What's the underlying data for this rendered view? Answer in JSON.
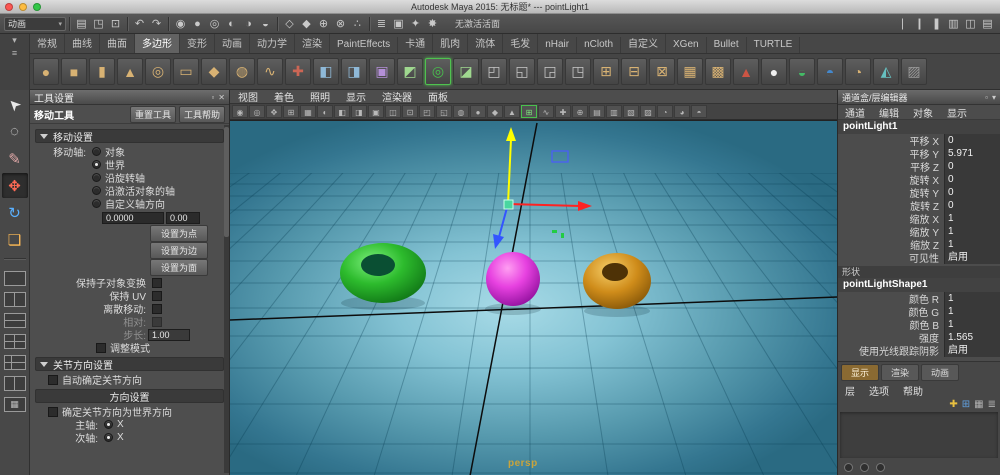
{
  "colors": {
    "close": "#fc5753",
    "minimize": "#fdbc40",
    "zoom": "#33c748",
    "selected": "#4fc24f",
    "viewport_center": "#a8dbe7",
    "viewport_edge": "#2a6a82",
    "object_green": "#2dbb2d",
    "object_magenta": "#e741e0",
    "object_orange": "#cf8c1a",
    "manip_x": "#ff2222",
    "manip_y": "#ffff00",
    "manip_z": "#3355ff"
  },
  "window": {
    "title": "Autodesk Maya 2015: 无标题*  ---  pointLight1"
  },
  "menubar": {
    "selector_label": "动画",
    "status_text": "无激活活面",
    "icon_groups": [
      [
        {
          "g": "▤",
          "n": "new-scene"
        },
        {
          "g": "◳",
          "n": "open-scene"
        },
        {
          "g": "⊡",
          "n": "save-scene"
        }
      ],
      [
        {
          "g": "↶",
          "n": "undo"
        },
        {
          "g": "↷",
          "n": "redo"
        }
      ],
      [
        {
          "g": "◉",
          "n": "select-hierarchy"
        },
        {
          "g": "●",
          "n": "select-object"
        },
        {
          "g": "◎",
          "n": "select-component"
        },
        {
          "g": "◐",
          "n": "select-mask-a"
        },
        {
          "g": "◑",
          "n": "select-mask-b"
        },
        {
          "g": "◒",
          "n": "select-mask-c"
        }
      ],
      [
        {
          "g": "◇",
          "n": "snap-grid"
        },
        {
          "g": "◆",
          "n": "snap-curve"
        },
        {
          "g": "⊕",
          "n": "snap-point"
        },
        {
          "g": "⊗",
          "n": "snap-plane"
        },
        {
          "g": "∴",
          "n": "snap-surface"
        }
      ],
      [
        {
          "g": "≣",
          "n": "construction-history"
        },
        {
          "g": "▣",
          "n": "render-frame"
        },
        {
          "g": "✦",
          "n": "ipr-render"
        },
        {
          "g": "✸",
          "n": "render-settings"
        }
      ]
    ],
    "right_icons": [
      {
        "g": "❘",
        "n": "sidebar-toggle-a"
      },
      {
        "g": "❙",
        "n": "sidebar-toggle-b"
      },
      {
        "g": "❚",
        "n": "sidebar-toggle-c"
      },
      {
        "g": "▥",
        "n": "channelbox-toggle"
      },
      {
        "g": "◫",
        "n": "attribute-editor-toggle"
      },
      {
        "g": "▤",
        "n": "toolsettings-toggle"
      }
    ]
  },
  "shelf": {
    "corner_icons": [
      {
        "g": "▾",
        "n": "shelf-tab-arrow"
      },
      {
        "g": "≡",
        "n": "shelf-menu"
      }
    ],
    "active_tab": "多边形",
    "tabs": [
      "常规",
      "曲线",
      "曲面",
      "多边形",
      "变形",
      "动画",
      "动力学",
      "渲染",
      "PaintEffects",
      "卡通",
      "肌肉",
      "流体",
      "毛发",
      "nHair",
      "nCloth",
      "自定义",
      "XGen",
      "Bullet",
      "TURTLE"
    ],
    "icons": [
      {
        "g": "●",
        "c": "#d8b273",
        "n": "poly-sphere"
      },
      {
        "g": "■",
        "c": "#d8b273",
        "n": "poly-cube"
      },
      {
        "g": "▮",
        "c": "#d8b273",
        "n": "poly-cylinder"
      },
      {
        "g": "▲",
        "c": "#d8b273",
        "n": "poly-cone"
      },
      {
        "g": "◎",
        "c": "#d8b273",
        "n": "poly-torus"
      },
      {
        "g": "▭",
        "c": "#d8b273",
        "n": "poly-plane"
      },
      {
        "g": "◆",
        "c": "#d8b273",
        "n": "poly-prism"
      },
      {
        "g": "◍",
        "c": "#d8b273",
        "n": "poly-pipe"
      },
      {
        "g": "∿",
        "c": "#d8b273",
        "n": "poly-helix"
      },
      {
        "g": "✚",
        "c": "#cc6655",
        "n": "poly-plus"
      },
      {
        "g": "◧",
        "c": "#8fb9d8",
        "n": "combine"
      },
      {
        "g": "◨",
        "c": "#8fb9d8",
        "n": "separate"
      },
      {
        "g": "▣",
        "c": "#b48fd8",
        "n": "boolean-cube"
      },
      {
        "g": "◩",
        "c": "#9fd88f",
        "n": "smooth"
      },
      {
        "g": "◎",
        "c": "#49c04d",
        "n": "poly-torus-active",
        "sel": true
      },
      {
        "g": "◪",
        "c": "#9fd88f",
        "n": "extrude"
      },
      {
        "g": "◰",
        "c": "#c8c8c8",
        "n": "bridge"
      },
      {
        "g": "◱",
        "c": "#c8c8c8",
        "n": "append"
      },
      {
        "g": "◲",
        "c": "#c8c8c8",
        "n": "split"
      },
      {
        "g": "◳",
        "c": "#c8c8c8",
        "n": "insert-edge-loop"
      },
      {
        "g": "⊞",
        "c": "#d8b273",
        "n": "bevel"
      },
      {
        "g": "⊟",
        "c": "#d8b273",
        "n": "reduce"
      },
      {
        "g": "⊠",
        "c": "#d8b273",
        "n": "triangulate"
      },
      {
        "g": "▦",
        "c": "#d8b273",
        "n": "quadrangulate"
      },
      {
        "g": "▩",
        "c": "#d8b273",
        "n": "mirror"
      },
      {
        "g": "▲",
        "c": "#cc5544",
        "n": "cone-red"
      },
      {
        "g": "●",
        "c": "#efefef",
        "n": "sphere-white"
      },
      {
        "g": "◒",
        "c": "#44bb66",
        "n": "checker-green"
      },
      {
        "g": "◓",
        "c": "#4488cc",
        "n": "checker-blue"
      },
      {
        "g": "◔",
        "c": "#d8b273",
        "n": "checker-gold"
      },
      {
        "g": "◭",
        "c": "#66c0c0",
        "n": "platonic"
      },
      {
        "g": "▨",
        "c": "#9a9a9a",
        "n": "texture-tile"
      }
    ]
  },
  "toolbox": {
    "tools": [
      {
        "g": "➤",
        "c": "#e8e8e8",
        "rot": -135,
        "n": "select-tool"
      },
      {
        "g": "◌",
        "c": "#e8e8e8",
        "n": "lasso-tool"
      },
      {
        "g": "✎",
        "c": "#e0a8a8",
        "n": "paint-select-tool"
      },
      {
        "g": "✥",
        "c": "#ff6a55",
        "sel": true,
        "n": "move-tool"
      },
      {
        "g": "↻",
        "c": "#5ab0ff",
        "n": "rotate-tool"
      },
      {
        "g": "❏",
        "c": "#ffbb55",
        "n": "scale-tool"
      }
    ],
    "layouts": [
      {
        "cls": "lo1",
        "n": "layout-single-pane"
      },
      {
        "cls": "lo2v",
        "n": "layout-two-panes-side"
      },
      {
        "cls": "lo2h",
        "n": "layout-two-panes-stacked"
      },
      {
        "cls": "lo4",
        "n": "layout-four-panes"
      },
      {
        "cls": "lo3",
        "n": "layout-three-panes"
      },
      {
        "cls": "lo2v",
        "n": "layout-outliner-persp"
      },
      {
        "g": "▦",
        "n": "layout-hypergraph"
      }
    ]
  },
  "tool_settings": {
    "panel_title": "工具设置",
    "tool_name": "移动工具",
    "reset_button": "重置工具",
    "help_button": "工具帮助",
    "move_section_header": "移动设置",
    "axis_label": "移动轴:",
    "axis_options": [
      {
        "label": "对象",
        "selected": false
      },
      {
        "label": "世界",
        "selected": true
      },
      {
        "label": "沿旋转轴",
        "selected": false
      },
      {
        "label": "沿激活对象的轴",
        "selected": false
      },
      {
        "label": "自定义轴方向",
        "selected": false
      }
    ],
    "axis_value": "0.0000",
    "axis_value2": "0.00",
    "set_buttons": [
      "设置为点",
      "设置为边",
      "设置为面"
    ],
    "keep_rows": [
      "保持子对象变换",
      "保持 UV"
    ],
    "discrete_label": "离散移动:",
    "relative_label": "相对:",
    "step_label": "步长:",
    "step_value": "1.00",
    "adjust_label": "调整模式",
    "joint_section_header": "关节方向设置",
    "auto_joint_label": "自动确定关节方向",
    "orient_subheader": "方向设置",
    "world_orient_label": "确定关节方向为世界方向",
    "primary_axis_label": "主轴:",
    "secondary_axis_label": "次轴:",
    "axis_x": "X"
  },
  "viewport": {
    "menus": [
      "视图",
      "着色",
      "照明",
      "显示",
      "渲染器",
      "面板"
    ],
    "toolbar_icons": [
      {
        "g": "◉",
        "n": "select-camera"
      },
      {
        "g": "◎",
        "n": "lock-camera"
      },
      {
        "g": "✥",
        "n": "camera-attributes"
      },
      {
        "g": "⊞",
        "n": "bookmark"
      },
      {
        "g": "▦",
        "n": "image-plane"
      },
      {
        "g": "◐",
        "n": "two-d-pan-zoom"
      },
      {
        "g": "◧",
        "n": "grease-pencil"
      },
      {
        "g": "◨",
        "n": "grid-toggle"
      },
      {
        "g": "▣",
        "n": "film-gate"
      },
      {
        "g": "◫",
        "n": "resolution-gate"
      },
      {
        "g": "⊡",
        "n": "gate-mask"
      },
      {
        "g": "◰",
        "n": "field-chart"
      },
      {
        "g": "◱",
        "n": "safe-action"
      },
      {
        "g": "◍",
        "n": "safe-title"
      },
      {
        "g": "●",
        "n": "wireframe-mode"
      },
      {
        "g": "◆",
        "n": "shaded-mode"
      },
      {
        "g": "▲",
        "n": "textured-mode"
      },
      {
        "g": "⊞",
        "c": "#7ee07e",
        "sel": true,
        "n": "use-all-lights"
      },
      {
        "g": "∿",
        "n": "shadows-toggle"
      },
      {
        "g": "✚",
        "n": "screen-space-ao"
      },
      {
        "g": "⊕",
        "n": "motion-blur"
      },
      {
        "g": "▤",
        "n": "multisample-aa"
      },
      {
        "g": "▥",
        "n": "sequence-time"
      },
      {
        "g": "▧",
        "n": "xray-mode"
      },
      {
        "g": "▨",
        "n": "xray-joints"
      },
      {
        "g": "◔",
        "n": "isolate-select"
      },
      {
        "g": "◕",
        "n": "exposure"
      },
      {
        "g": "◓",
        "n": "gamma"
      }
    ],
    "camera_label": "persp"
  },
  "channel_box": {
    "header": "通道盒/层编辑器",
    "header_icons": [
      {
        "g": "▫",
        "n": "channelbox-display-options"
      },
      {
        "g": "▾",
        "n": "channelbox-collapse"
      }
    ],
    "menus": [
      "通道",
      "编辑",
      "对象",
      "显示"
    ],
    "object_name": "pointLight1",
    "attributes": [
      [
        "平移 X",
        "0"
      ],
      [
        "平移 Y",
        "5.971"
      ],
      [
        "平移 Z",
        "0"
      ],
      [
        "旋转 X",
        "0"
      ],
      [
        "旋转 Y",
        "0"
      ],
      [
        "旋转 Z",
        "0"
      ],
      [
        "缩放 X",
        "1"
      ],
      [
        "缩放 Y",
        "1"
      ],
      [
        "缩放 Z",
        "1"
      ],
      [
        "可见性",
        "启用"
      ]
    ],
    "shapes_header": "形状",
    "shape_name": "pointLightShape1",
    "shape_attributes": [
      [
        "颜色 R",
        "1"
      ],
      [
        "颜色 G",
        "1"
      ],
      [
        "颜色 B",
        "1"
      ],
      [
        "强度",
        "1.565"
      ],
      [
        "使用光线跟踪阴影",
        "启用"
      ]
    ],
    "bottom_tabs": [
      "显示",
      "渲染",
      "动画"
    ],
    "active_bottom_tab": "显示",
    "layer_menus": [
      "层",
      "选项",
      "帮助"
    ],
    "layer_icons": [
      {
        "g": "✚",
        "c": "#e8c040",
        "n": "create-empty-layer"
      },
      {
        "g": "⊞",
        "c": "#60a0e0",
        "n": "create-layer-from-selected"
      },
      {
        "g": "▦",
        "c": "#b0b0b0",
        "n": "layer-move-up"
      },
      {
        "g": "≣",
        "c": "#b0b0b0",
        "n": "layer-options"
      }
    ]
  }
}
